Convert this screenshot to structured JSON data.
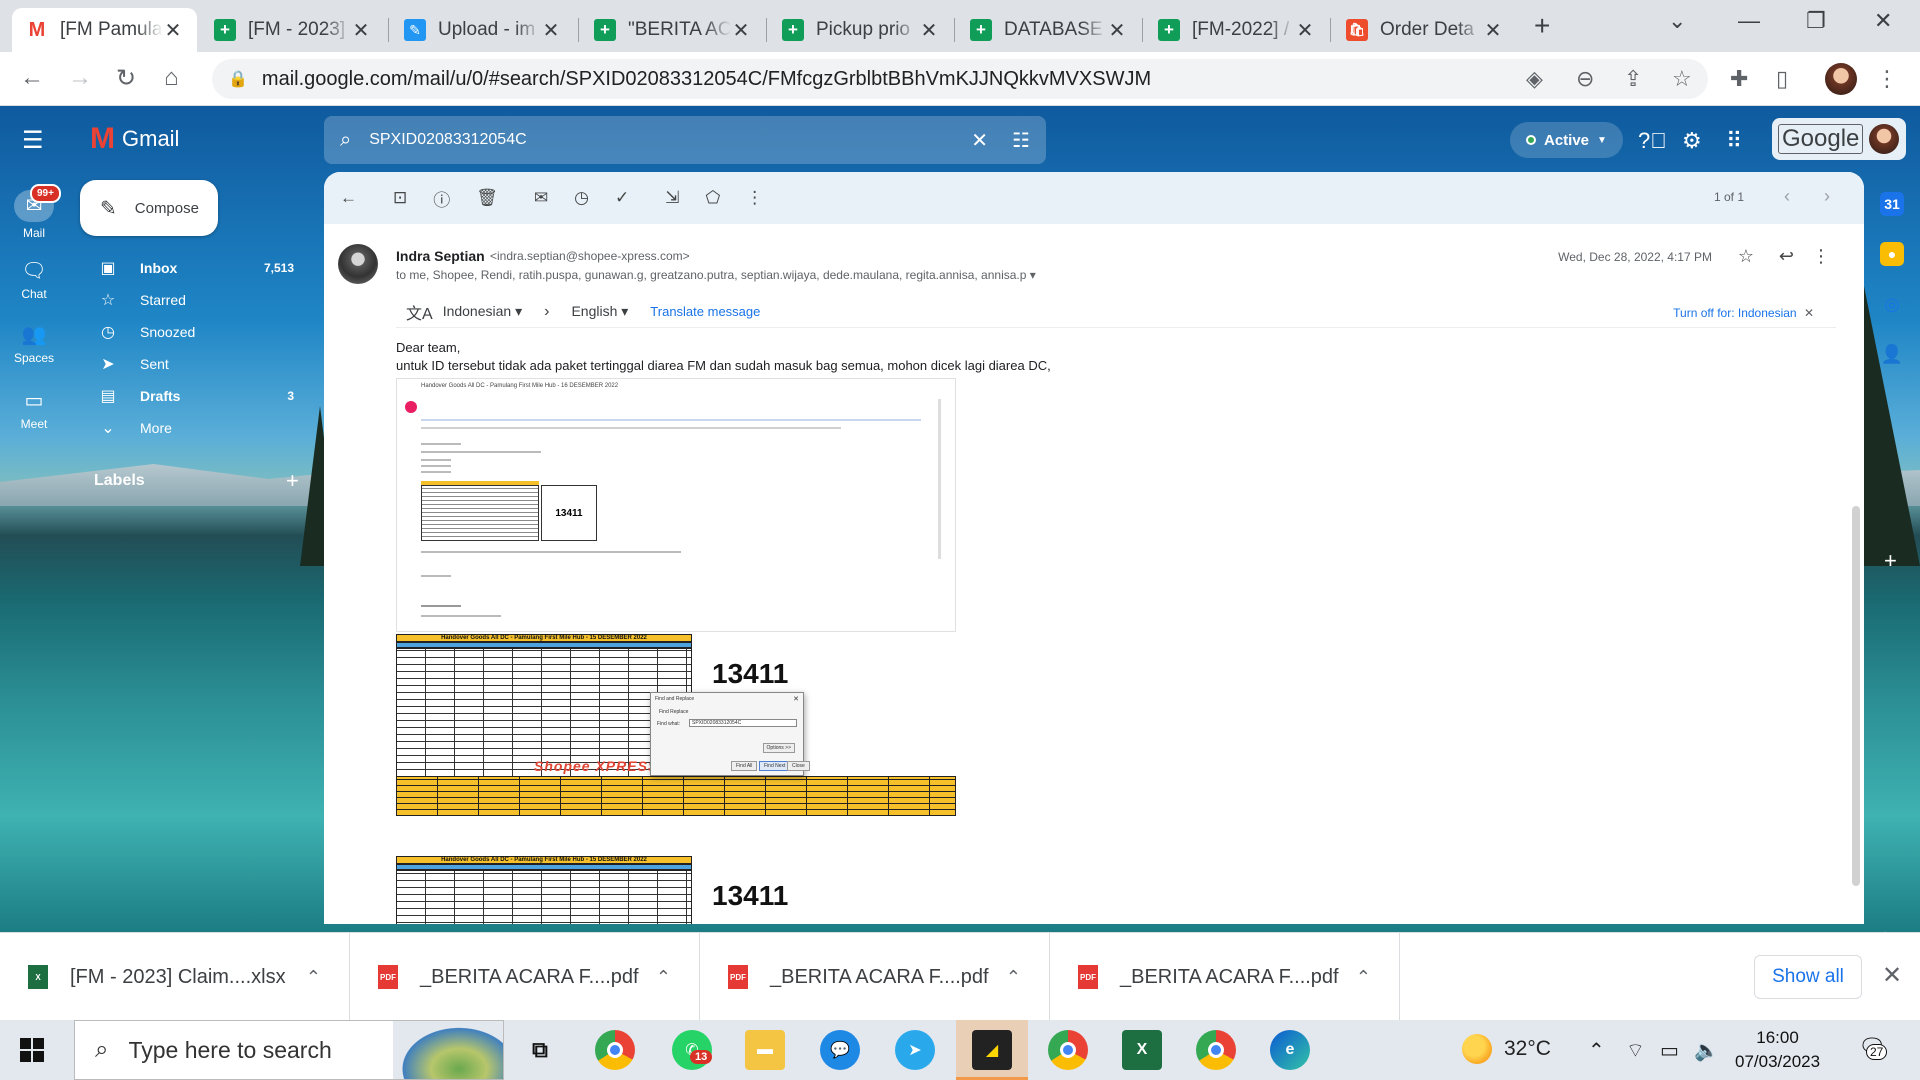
{
  "browser": {
    "tabs": [
      {
        "title": "[FM Pamula",
        "favicon": "gmail-icon",
        "active": true
      },
      {
        "title": "[FM - 2023]",
        "favicon": "sheets-icon"
      },
      {
        "title": "Upload - im",
        "favicon": "upload-icon"
      },
      {
        "title": "\"BERITA AC",
        "favicon": "sheets-icon"
      },
      {
        "title": "Pickup prio",
        "favicon": "sheets-icon"
      },
      {
        "title": "DATABASE",
        "favicon": "sheets-icon"
      },
      {
        "title": "[FM-2022] /",
        "favicon": "sheets-icon"
      },
      {
        "title": "Order Deta",
        "favicon": "shopee-icon"
      }
    ],
    "url": "mail.google.com/mail/u/0/#search/SPXID02083312054C/FMfcgzGrblbtBBhVmKJJNQkkvMVXSWJM"
  },
  "gmail": {
    "brand": "Gmail",
    "search_query": "SPXID02083312054C",
    "status": "Active",
    "google_word": "Google",
    "rail": {
      "mail": "Mail",
      "mail_badge": "99+",
      "chat": "Chat",
      "spaces": "Spaces",
      "meet": "Meet"
    },
    "compose": "Compose",
    "nav": [
      {
        "label": "Inbox",
        "count": "7,513",
        "icon": "inbox-icon"
      },
      {
        "label": "Starred",
        "count": "",
        "icon": "star-icon"
      },
      {
        "label": "Snoozed",
        "count": "",
        "icon": "clock-icon"
      },
      {
        "label": "Sent",
        "count": "",
        "icon": "send-icon"
      },
      {
        "label": "Drafts",
        "count": "3",
        "icon": "draft-icon"
      },
      {
        "label": "More",
        "count": "",
        "icon": "chevron-down-icon"
      }
    ],
    "labels_header": "Labels",
    "pager": "1 of 1"
  },
  "message": {
    "sender_name": "Indra Septian",
    "sender_email": "<indra.septian@shopee-xpress.com>",
    "recipients": "to me, Shopee, Rendi, ratih.puspa, gunawan.g, greatzano.putra, septian.wijaya, dede.maulana, regita.annisa, annisa.p",
    "date": "Wed, Dec 28, 2022, 4:17 PM",
    "translate": {
      "from": "Indonesian",
      "to": "English",
      "link": "Translate message",
      "turn_off": "Turn off for: Indonesian"
    },
    "body_line1": "Dear team,",
    "body_line2": "untuk ID tersebut tidak ada paket tertinggal diarea FM dan sudah masuk bag semua, mohon dicek lagi diarea DC,",
    "attachments": {
      "shot1_title": "Handover Goods All DC - Pamulang First Mile Hub - 16 DESEMBER 2022",
      "shot1_number": "13411",
      "sheet_title": "Handover Goods All DC - Pamulang First Mile Hub - 15 DESEMBER 2022",
      "sheet_number": "13411",
      "stamp": "Shopee XPRESS",
      "dialog_title": "Find and Replace",
      "dialog_tabs": "Find    Replace",
      "dialog_label": "Find what:",
      "dialog_value": "SPXID02083312054C",
      "dialog_options": "Options >>",
      "dialog_find_all": "Find All",
      "dialog_find_next": "Find Next",
      "dialog_close": "Close",
      "sheet3_title": "Handover Goods All DC - Pamulang First Mile Hub - 15 DESEMBER 2022",
      "sheet3_number": "13411"
    }
  },
  "downloads": {
    "items": [
      {
        "name": "[FM - 2023] Claim....xlsx",
        "type": "xlsx"
      },
      {
        "name": "_BERITA ACARA F....pdf",
        "type": "pdf"
      },
      {
        "name": "_BERITA ACARA F....pdf",
        "type": "pdf"
      },
      {
        "name": "_BERITA ACARA F....pdf",
        "type": "pdf"
      }
    ],
    "show_all": "Show all"
  },
  "taskbar": {
    "search_placeholder": "Type here to search",
    "whatsapp_badge": "13",
    "weather": "32°C",
    "time": "16:00",
    "date": "07/03/2023",
    "notifications": "27"
  },
  "colors": {
    "gmail_red": "#ea4335",
    "link_blue": "#1a73e8",
    "sheet_yellow": "#f6c02b",
    "active_green": "#34a853"
  }
}
